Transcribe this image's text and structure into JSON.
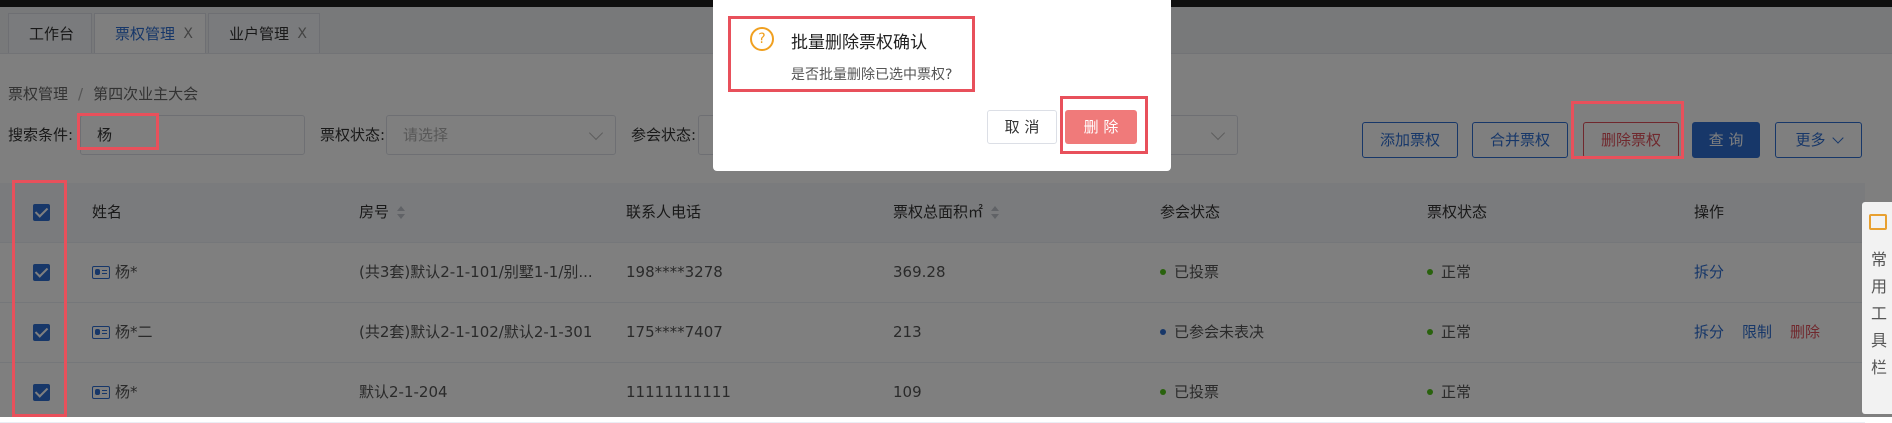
{
  "tabs": [
    {
      "label": "工作台",
      "close": ""
    },
    {
      "label": "票权管理",
      "close": "X"
    },
    {
      "label": "业户管理",
      "close": "X"
    }
  ],
  "breadcrumb": [
    "票权管理",
    "/",
    "第四次业主大会"
  ],
  "filters": {
    "search_label": "搜索条件:",
    "search_value": "杨",
    "ticket_status_label": "票权状态:",
    "ticket_status_placeholder": "请选择",
    "meeting_status_label": "参会状态:"
  },
  "toolbar": {
    "add": "添加票权",
    "merge": "合并票权",
    "delete": "删除票权",
    "query": "查 询",
    "more": "更多"
  },
  "table": {
    "columns": [
      "姓名",
      "房号",
      "联系人电话",
      "票权总面积㎡",
      "参会状态",
      "票权状态",
      "操作"
    ],
    "rows": [
      {
        "name": "杨*",
        "room": "(共3套)默认2-1-101/别墅1-1/别...",
        "phone": "198****3278",
        "area": "369.28",
        "meeting": "已投票",
        "meeting_color": "#52c41a",
        "status": "正常",
        "actions": [
          "拆分"
        ]
      },
      {
        "name": "杨*二",
        "room": "(共2套)默认2-1-102/默认2-1-301",
        "phone": "175****7407",
        "area": "213",
        "meeting": "已参会未表决",
        "meeting_color": "#2f6fd3",
        "status": "正常",
        "actions": [
          "拆分",
          "限制",
          "删除"
        ]
      },
      {
        "name": "杨*",
        "room": "默认2-1-204",
        "phone": "11111111111",
        "area": "109",
        "meeting": "已投票",
        "meeting_color": "#52c41a",
        "status": "正常",
        "actions": []
      }
    ]
  },
  "dialog": {
    "icon": "?",
    "title": "批量删除票权确认",
    "message": "是否批量删除已选中票权?",
    "cancel": "取 消",
    "confirm": "删 除"
  },
  "side_tool": {
    "label": "常用工具栏"
  },
  "colors": {
    "primary": "#2f6fd3",
    "danger": "#e0505a",
    "highlight": "#e8505b"
  }
}
